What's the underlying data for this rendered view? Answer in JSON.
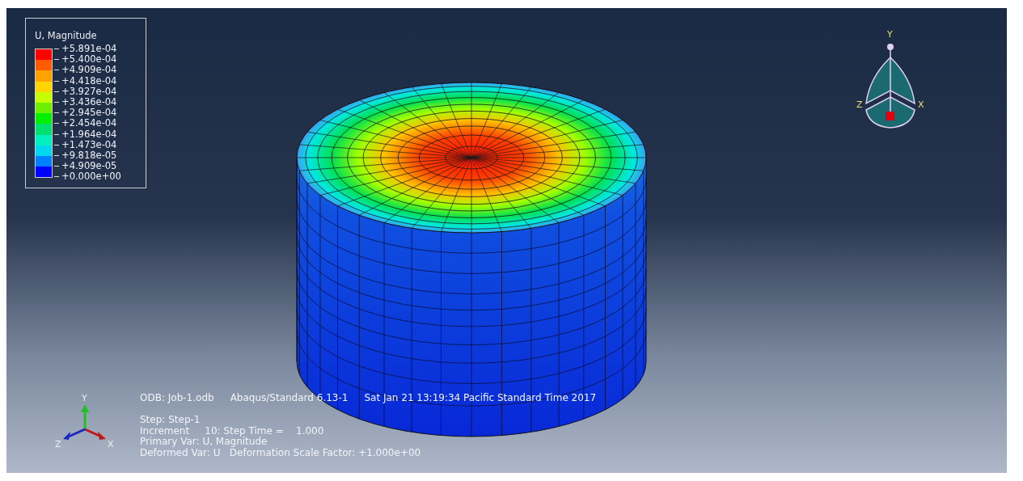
{
  "legend": {
    "title": "U, Magnitude",
    "labels": [
      "+5.891e-04",
      "+5.400e-04",
      "+4.909e-04",
      "+4.418e-04",
      "+3.927e-04",
      "+3.436e-04",
      "+2.945e-04",
      "+2.454e-04",
      "+1.964e-04",
      "+1.473e-04",
      "+9.818e-05",
      "+4.909e-05",
      "+0.000e+00"
    ],
    "bands": [
      {
        "color": "#ff0000"
      },
      {
        "color": "#ff5a00"
      },
      {
        "color": "#ffa200"
      },
      {
        "color": "#ffd400"
      },
      {
        "color": "#c8ff00"
      },
      {
        "color": "#6cf000"
      },
      {
        "color": "#00f000"
      },
      {
        "color": "#00e070"
      },
      {
        "color": "#00f0c0"
      },
      {
        "color": "#00d8f0"
      },
      {
        "color": "#0080ff"
      },
      {
        "color": "#0000ff"
      }
    ]
  },
  "view_triad": {
    "y": "Y",
    "z": "Z",
    "x": "X"
  },
  "axis_triad": {
    "y": "Y",
    "z": "Z",
    "x": "X"
  },
  "info": {
    "header": [
      "ODB: Job-1.odb",
      "Abaqus/Standard 6.13-1",
      "Sat Jan 21 13:19:34 Pacific Standard Time 2017"
    ],
    "lines": [
      "Step: Step-1",
      "Increment     10: Step Time =    1.000",
      "Primary Var: U, Magnitude",
      "Deformed Var: U   Deformation Scale Factor: +1.000e+00"
    ]
  }
}
